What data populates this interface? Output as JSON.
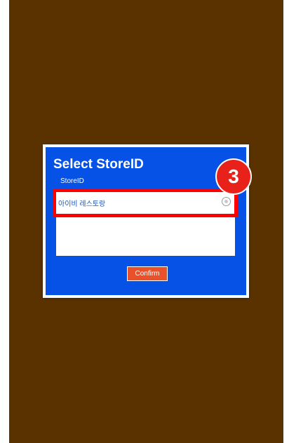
{
  "dialog": {
    "title": "Select StoreID",
    "field_label": "StoreID",
    "options": [
      {
        "label": "아이비 레스토랑",
        "selected": false
      }
    ],
    "confirm_label": "Confirm"
  },
  "annotation": {
    "step_number": "3"
  },
  "colors": {
    "background": "#5a3200",
    "dialog": "#0652e6",
    "confirm_button": "#e8512a",
    "highlight": "#ff0000"
  },
  "icons": {
    "option_radio": "radio-unchecked-icon"
  }
}
